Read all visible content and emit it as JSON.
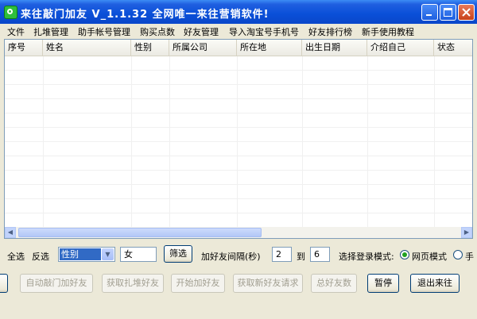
{
  "window": {
    "title": "来往敲门加友 V_1.1.32  全网唯一来往营销软件!"
  },
  "menu": [
    "文件",
    "扎堆管理",
    "助手帐号管理",
    "购买点数",
    "好友管理",
    "导入淘宝号手机号",
    "好友排行榜",
    "新手使用教程"
  ],
  "table": {
    "columns": [
      "序号",
      "姓名",
      "性别",
      "所属公司",
      "所在地",
      "出生日期",
      "介绍自己",
      "状态"
    ],
    "rows": []
  },
  "filter": {
    "select_all": "全选",
    "invert": "反选",
    "field_selected": "性别",
    "value": "女",
    "filter_button": "筛选",
    "interval_label": "加好友间隔(秒)",
    "interval_from": "2",
    "to_label": "到",
    "interval_to": "6",
    "login_mode_label": "选择登录模式:",
    "mode_web": "网页模式",
    "mode_phone": "手"
  },
  "actions": {
    "auto_add": "自动敲门加好友",
    "get_group": "获取扎堆好友",
    "start_add": "开始加好友",
    "get_requests": "获取新好友请求",
    "total": "总好友数",
    "pause": "暂停",
    "quit": "退出来往"
  },
  "icons": [
    "app-icon",
    "minimize-icon",
    "maximize-icon",
    "close-icon",
    "chevron-down-icon",
    "arrow-left-icon",
    "arrow-right-icon"
  ]
}
